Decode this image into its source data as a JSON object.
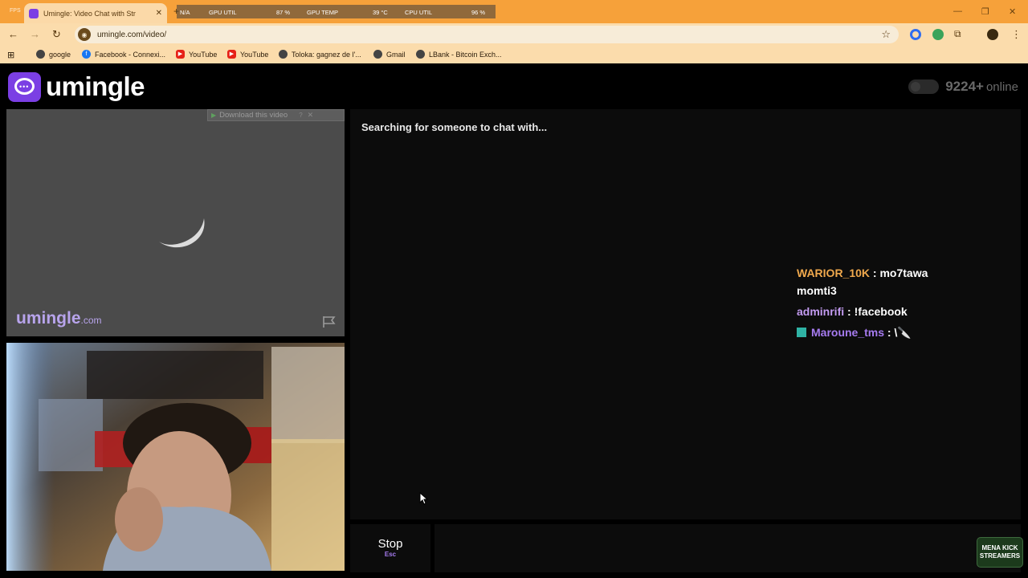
{
  "browser": {
    "tab_title": "Umingle: Video Chat with Str",
    "fps_label": "FPS",
    "url": "umingle.com/video/",
    "osd": {
      "na": "N/A",
      "gpu_util_label": "GPU UTIL",
      "gpu_util_value": "87 %",
      "gpu_temp_label": "GPU TEMP",
      "gpu_temp_value": "39 °C",
      "cpu_util_label": "CPU UTIL",
      "cpu_util_value": "96 %"
    },
    "bookmarks": [
      {
        "label": "google",
        "icon": "globe-icon"
      },
      {
        "label": "Facebook - Connexi...",
        "icon": "facebook-icon"
      },
      {
        "label": "YouTube",
        "icon": "youtube-icon"
      },
      {
        "label": "YouTube",
        "icon": "youtube-icon"
      },
      {
        "label": "Toloka: gagnez de l'...",
        "icon": "globe-icon"
      },
      {
        "label": "Gmail",
        "icon": "globe-icon"
      },
      {
        "label": "LBank - Bitcoin Exch...",
        "icon": "globe-icon"
      }
    ],
    "colors": {
      "frame": "#f6a13a",
      "toolbar": "#fbdcac"
    }
  },
  "site": {
    "logo_text": "umingle",
    "online_count": "9224+",
    "online_label": "online",
    "download_label": "Download this video",
    "watermark_brand": "umingle",
    "watermark_tld": ".com",
    "searching_text": "Searching for someone to chat with...",
    "stop_label": "Stop",
    "stop_shortcut": "Esc",
    "accent": "#7b3fe4"
  },
  "stream_chat": [
    {
      "user": "WARIOR_10K",
      "sep": " : ",
      "message": "mo7tawa momti3"
    },
    {
      "user": "adminrifi",
      "sep": " : ",
      "message": "!facebook"
    },
    {
      "user": "Maroune_tms",
      "sep": " : ",
      "message": "\\🔪"
    }
  ],
  "overlay_badge": {
    "line1": "MENA KICK",
    "line2": "STREAMERS"
  }
}
